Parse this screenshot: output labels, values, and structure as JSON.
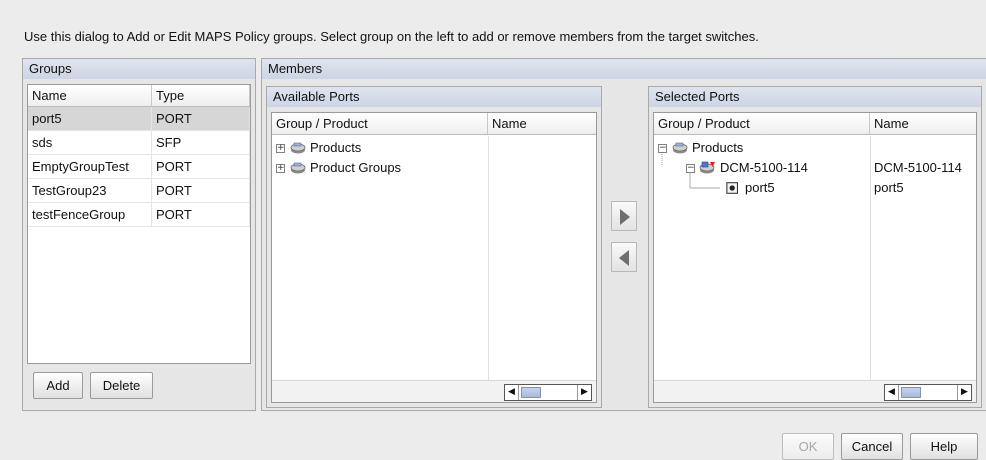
{
  "instruction": "Use this dialog to Add or Edit MAPS Policy groups. Select group on the left to add or remove members from the target switches.",
  "groups": {
    "title": "Groups",
    "columns": [
      "Name",
      "Type"
    ],
    "rows": [
      {
        "name": "port5",
        "type": "PORT",
        "selected": true
      },
      {
        "name": "sds",
        "type": "SFP"
      },
      {
        "name": "EmptyGroupTest",
        "type": "PORT"
      },
      {
        "name": "TestGroup23",
        "type": "PORT"
      },
      {
        "name": "testFenceGroup",
        "type": "PORT"
      }
    ],
    "add_label": "Add",
    "delete_label": "Delete"
  },
  "members": {
    "title": "Members",
    "available": {
      "title": "Available Ports",
      "columns": [
        "Group / Product",
        "Name"
      ],
      "nodes": [
        {
          "label": "Products",
          "expander": "+"
        },
        {
          "label": "Product Groups",
          "expander": "+"
        }
      ]
    },
    "selected": {
      "title": "Selected Ports",
      "columns": [
        "Group / Product",
        "Name"
      ],
      "nodes": [
        {
          "label": "Products",
          "expander": "−",
          "name": ""
        },
        {
          "label": "DCM-5100-114",
          "expander": "−",
          "name": "DCM-5100-114"
        },
        {
          "label": "port5",
          "name": "port5"
        }
      ]
    }
  },
  "footer": {
    "ok_label": "OK",
    "cancel_label": "Cancel",
    "help_label": "Help"
  },
  "icons": {
    "product": "products-icon",
    "switch": "switch-icon",
    "port": "port-icon",
    "add_arrow": "move-right-icon",
    "remove_arrow": "move-left-icon"
  }
}
